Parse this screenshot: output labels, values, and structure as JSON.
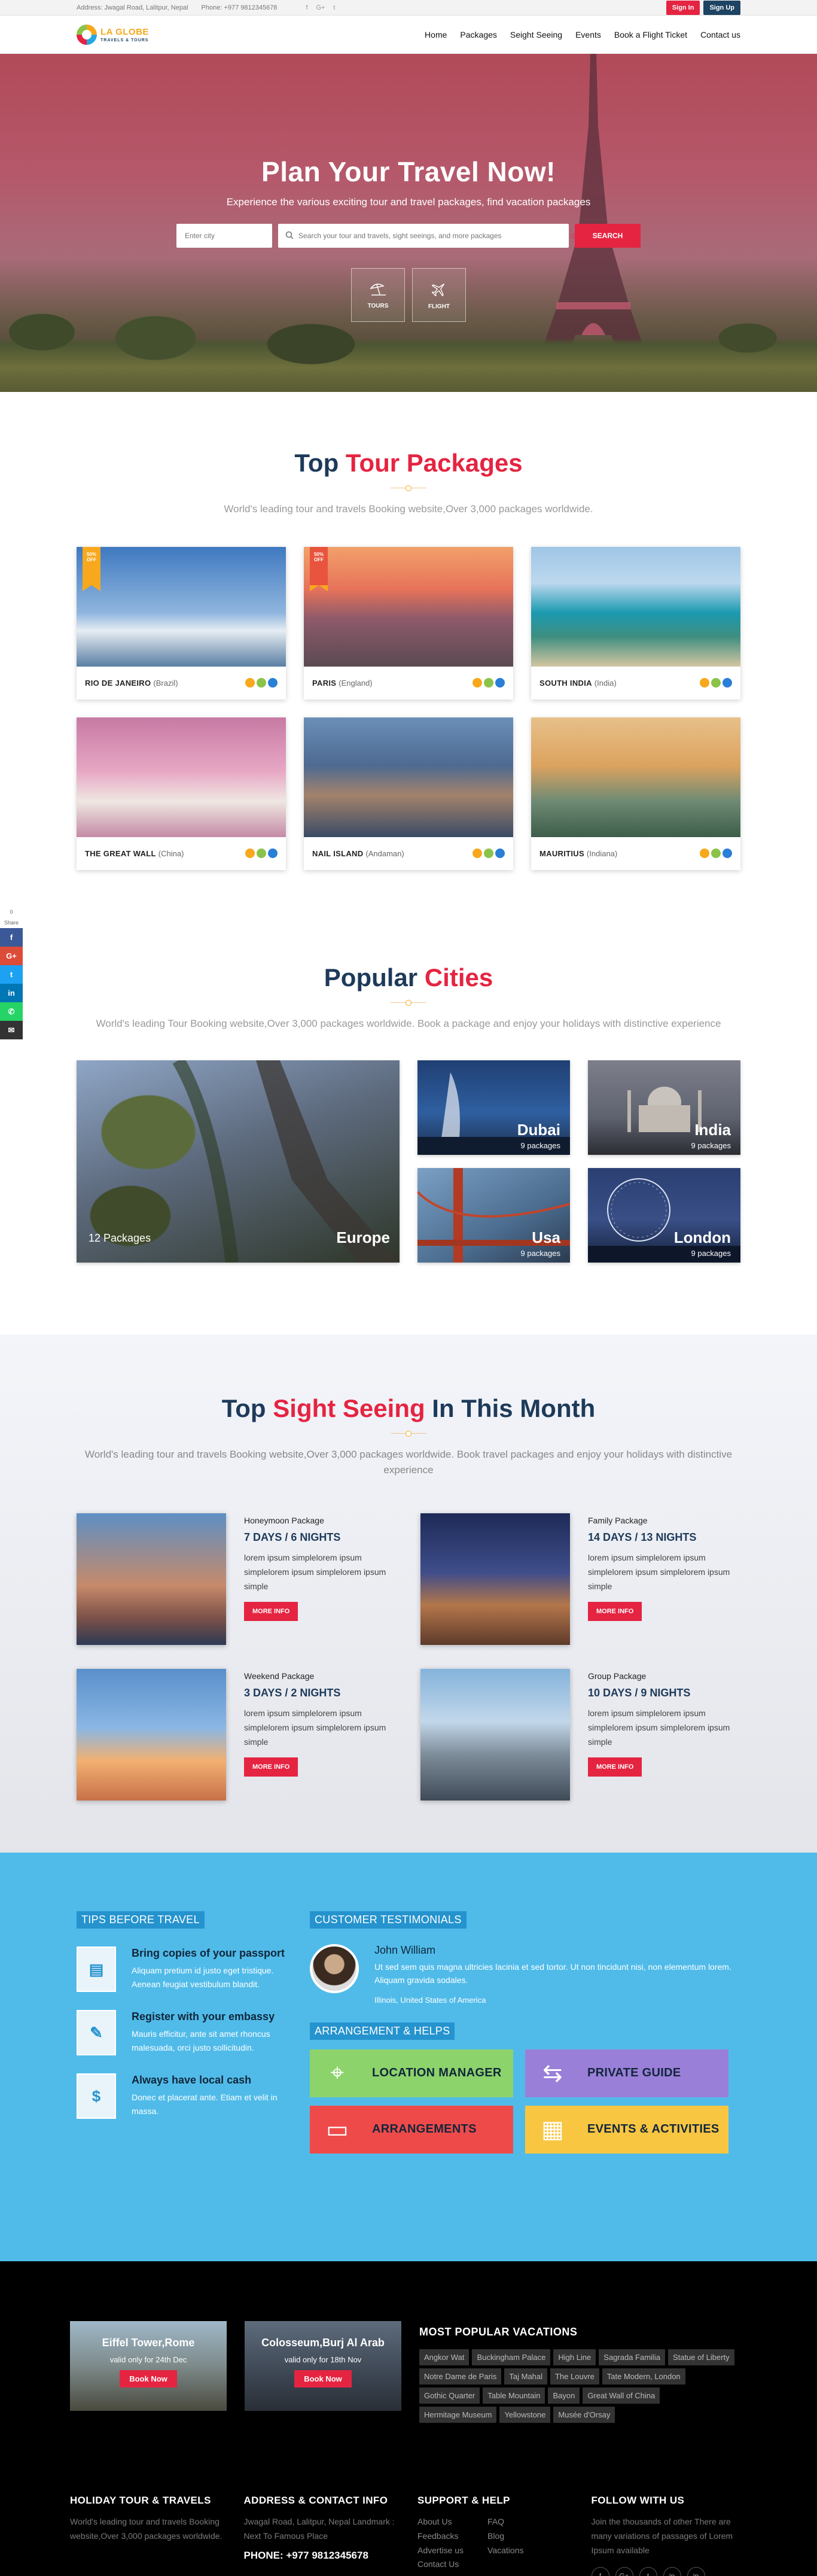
{
  "topbar": {
    "address": "Address: Jwagal Road, Lalitpur, Nepal",
    "phone": "Phone: +977 9812345678",
    "social": [
      "f",
      "G+",
      "t"
    ],
    "signin": "Sign In",
    "signup": "Sign Up"
  },
  "logo": {
    "line1": "LA GLOBE",
    "line2": "TRAVELS & TOURS"
  },
  "nav": [
    "Home",
    "Packages",
    "Seight Seeing",
    "Events",
    "Book a Flight Ticket",
    "Contact us"
  ],
  "hero": {
    "title": "Plan Your Travel Now!",
    "subtitle": "Experience the various exciting tour and travel packages, find vacation packages",
    "city_placeholder": "Enter city",
    "search_placeholder": "Search your tour and travels, sight seeings, and more packages",
    "search_button": "SEARCH",
    "cards": [
      "TOURS",
      "FLIGHT"
    ]
  },
  "packages": {
    "title_a": "Top",
    "title_b": "Tour Packages",
    "subtitle": "World's leading tour and travels Booking website,Over 3,000 packages worldwide.",
    "items": [
      {
        "name": "RIO DE JANEIRO",
        "sub": "(Brazil)",
        "ribbon": "50% OFF",
        "ribbon_color": "#f7a81d"
      },
      {
        "name": "PARIS",
        "sub": "(England)",
        "ribbon": "50% OFF",
        "ribbon_color": "#e8543d"
      },
      {
        "name": "SOUTH INDIA",
        "sub": "(India)",
        "ribbon": ""
      },
      {
        "name": "THE GREAT WALL",
        "sub": "(China)",
        "ribbon": ""
      },
      {
        "name": "NAIL ISLAND",
        "sub": "(Andaman)",
        "ribbon": ""
      },
      {
        "name": "MAURITIUS",
        "sub": "(Indiana)",
        "ribbon": ""
      }
    ]
  },
  "share": {
    "count": "0",
    "label": "Share",
    "buttons": [
      {
        "icon": "f",
        "color": "#3b5998"
      },
      {
        "icon": "G+",
        "color": "#dd4b39"
      },
      {
        "icon": "t",
        "color": "#1da1f2"
      },
      {
        "icon": "in",
        "color": "#0077b5"
      },
      {
        "icon": "✆",
        "color": "#25d366"
      },
      {
        "icon": "✉",
        "color": "#333333"
      }
    ]
  },
  "cities": {
    "title_a": "Popular",
    "title_b": "Cities",
    "subtitle": "World's leading Tour Booking website,Over 3,000 packages worldwide. Book a package and enjoy your holidays with distinctive experience",
    "items": [
      {
        "name": "Europe",
        "count": "12 Packages"
      },
      {
        "name": "Dubai",
        "count": "9 packages"
      },
      {
        "name": "India",
        "count": "9 packages"
      },
      {
        "name": "Usa",
        "count": "9 packages"
      },
      {
        "name": "London",
        "count": "9 packages"
      }
    ]
  },
  "sight": {
    "title_a": "Top",
    "title_b": "Sight Seeing",
    "title_c": "In This Month",
    "subtitle": "World's leading tour and travels Booking website,Over 3,000 packages worldwide. Book travel packages and enjoy your holidays with distinctive experience",
    "items": [
      {
        "cat": "Honeymoon Package",
        "days": "7 DAYS / 6 NIGHTS",
        "desc": "lorem ipsum simplelorem ipsum simplelorem ipsum simplelorem ipsum simple",
        "btn": "MORE INFO"
      },
      {
        "cat": "Family Package",
        "days": "14 DAYS / 13 NIGHTS",
        "desc": "lorem ipsum simplelorem ipsum simplelorem ipsum simplelorem ipsum simple",
        "btn": "MORE INFO"
      },
      {
        "cat": "Weekend Package",
        "days": "3 DAYS / 2 NIGHTS",
        "desc": "lorem ipsum simplelorem ipsum simplelorem ipsum simplelorem ipsum simple",
        "btn": "MORE INFO"
      },
      {
        "cat": "Group Package",
        "days": "10 DAYS / 9 NIGHTS",
        "desc": "lorem ipsum simplelorem ipsum simplelorem ipsum simplelorem ipsum simple",
        "btn": "MORE INFO"
      }
    ]
  },
  "tips": {
    "title": "TIPS BEFORE TRAVEL",
    "items": [
      {
        "title": "Bring copies of your passport",
        "text": "Aliquam pretium id justo eget tristique. Aenean feugiat vestibulum blandit."
      },
      {
        "title": "Register with your embassy",
        "text": "Mauris efficitur, ante sit amet rhoncus malesuada, orci justo sollicitudin."
      },
      {
        "title": "Always have local cash",
        "text": "Donec et placerat ante. Etiam et velit in massa."
      }
    ]
  },
  "testimonial": {
    "title": "CUSTOMER TESTIMONIALS",
    "name": "John William",
    "text": "Ut sed sem quis magna ultricies lacinia et sed tortor. Ut non tincidunt nisi, non elementum lorem. Aliquam gravida sodales.",
    "location": "Illinois, United States of America"
  },
  "helps": {
    "title": "ARRANGEMENT & HELPS",
    "items": [
      {
        "label": "LOCATION MANAGER",
        "color": "#8cd36b"
      },
      {
        "label": "PRIVATE GUIDE",
        "color": "#9a7fd9"
      },
      {
        "label": "ARRANGEMENTS",
        "color": "#ef4a4a"
      },
      {
        "label": "EVENTS & ACTIVITIES",
        "color": "#f9c642"
      }
    ]
  },
  "promos": [
    {
      "title": "Eiffel Tower,Rome",
      "sub": "valid only for 24th Dec",
      "btn": "Book Now"
    },
    {
      "title": "Colosseum,Burj Al Arab",
      "sub": "valid only for 18th Nov",
      "btn": "Book Now"
    }
  ],
  "vacations": {
    "title": "MOST POPULAR VACATIONS",
    "tags": [
      "Angkor Wat",
      "Buckingham Palace",
      "High Line",
      "Sagrada Familia",
      "Statue of Liberty",
      "Notre Dame de Paris",
      "Taj Mahal",
      "The Louvre",
      "Tate Modern, London",
      "Gothic Quarter",
      "Table Mountain",
      "Bayon",
      "Great Wall of China",
      "Hermitage Museum",
      "Yellowstone",
      "Musée d'Orsay"
    ]
  },
  "footer": {
    "c1_title": "HOLIDAY TOUR & TRAVELS",
    "c1_text": "World's leading tour and travels Booking website,Over 3,000 packages worldwide.",
    "c2_title": "ADDRESS & CONTACT INFO",
    "c2_text": "Jwagal Road, Lalitpur, Nepal Landmark : Next To Famous Place",
    "c2_phone": "PHONE: +977 9812345678",
    "c3_title": "SUPPORT & HELP",
    "c3_links_a": [
      "About Us",
      "Feedbacks",
      "Advertise us",
      "Contact Us"
    ],
    "c3_links_b": [
      "FAQ",
      "Blog",
      "Vacations"
    ],
    "c4_title": "FOLLOW WITH US",
    "c4_text": "Join the thousands of other There are many variations of passages of Lorem Ipsum available",
    "c4_social": [
      "f",
      "G+",
      "t",
      "in",
      "in"
    ]
  }
}
